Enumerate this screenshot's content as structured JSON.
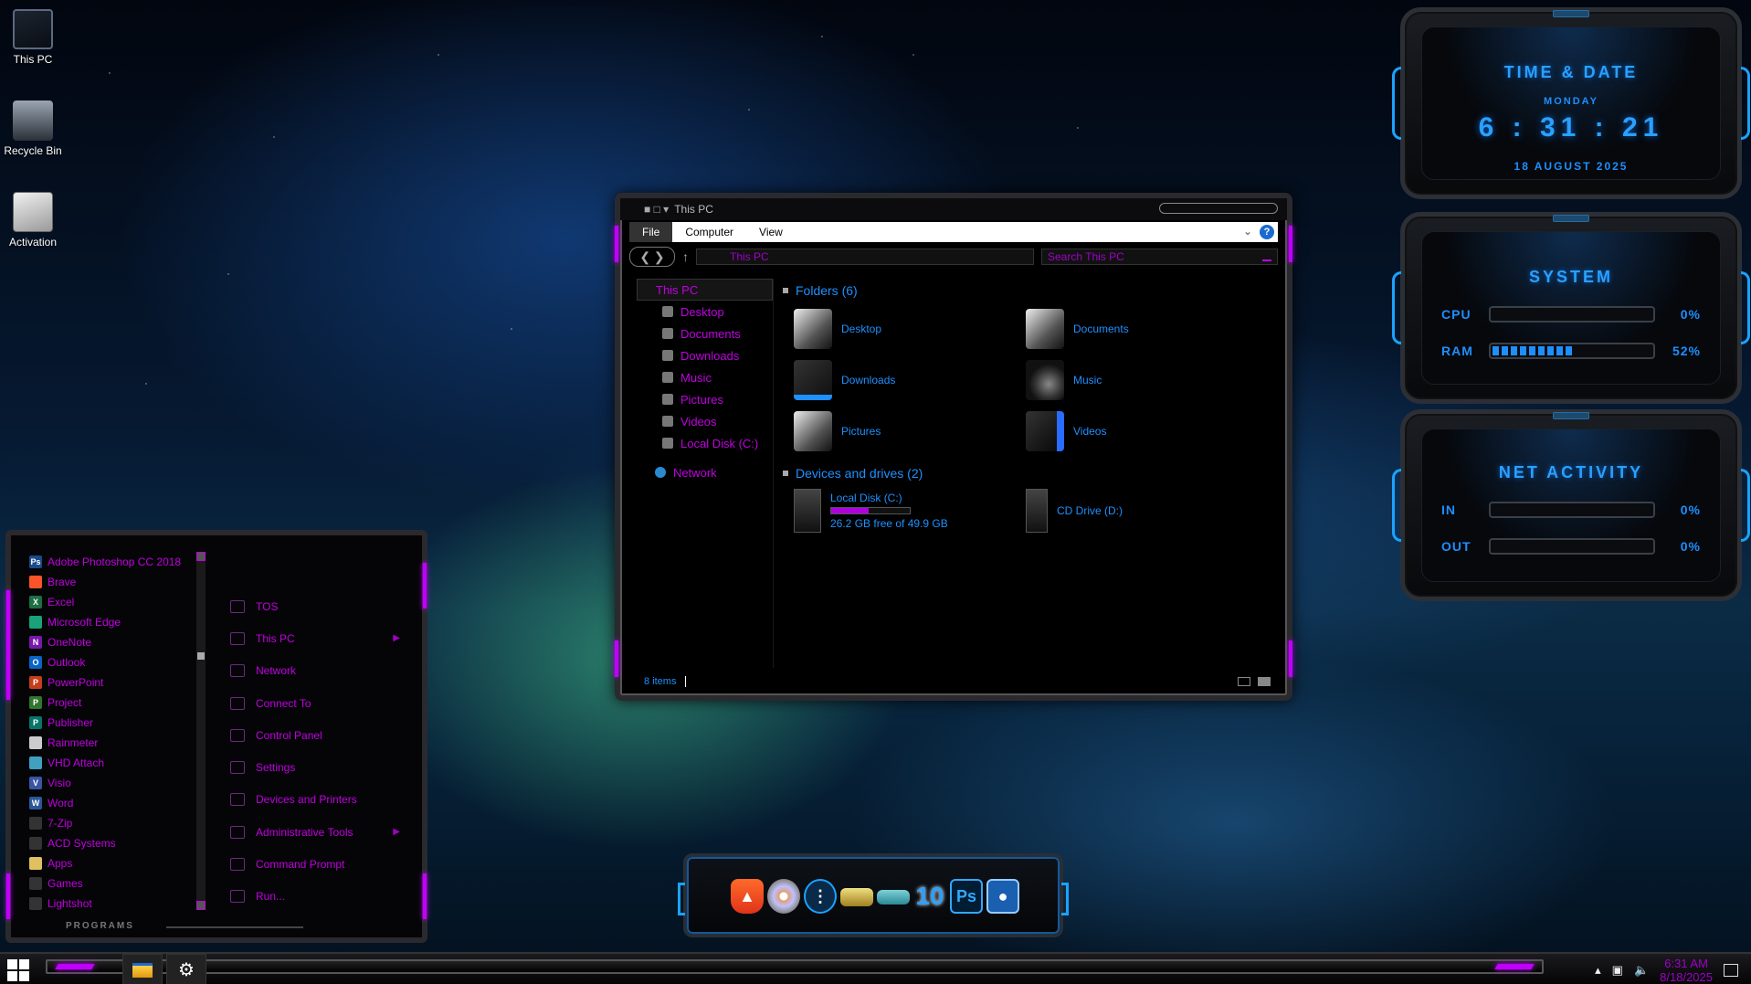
{
  "desktop": {
    "icons": [
      {
        "label": "This PC"
      },
      {
        "label": "Recycle Bin"
      },
      {
        "label": "Activation"
      }
    ]
  },
  "explorer": {
    "title": "This PC",
    "ribbon_tabs": [
      "File",
      "Computer",
      "View"
    ],
    "help_glyph": "?",
    "address": "This PC",
    "search_placeholder": "Search This PC",
    "nav": {
      "root": "This PC",
      "items": [
        "Desktop",
        "Documents",
        "Downloads",
        "Music",
        "Pictures",
        "Videos",
        "Local Disk (C:)"
      ],
      "network": "Network"
    },
    "folders_header": "Folders (6)",
    "folders": [
      "Desktop",
      "Documents",
      "Downloads",
      "Music",
      "Pictures",
      "Videos"
    ],
    "drives_header": "Devices and drives (2)",
    "drives": [
      {
        "name": "Local Disk (C:)",
        "free_text": "26.2 GB free of 49.9 GB",
        "used_fraction": 0.475
      },
      {
        "name": "CD Drive (D:)"
      }
    ],
    "status": "8 items"
  },
  "start_menu": {
    "programs": [
      {
        "label": "Adobe Photoshop CC 2018",
        "icon": "photoshop-icon",
        "badge": "Ps",
        "color": "#1a4a8a"
      },
      {
        "label": "Brave",
        "icon": "brave-icon",
        "badge": "",
        "color": "#fb542b"
      },
      {
        "label": "Excel",
        "icon": "excel-icon",
        "badge": "X",
        "color": "#1d6f42"
      },
      {
        "label": "Microsoft Edge",
        "icon": "edge-icon",
        "badge": "",
        "color": "#1aa37a"
      },
      {
        "label": "OneNote",
        "icon": "onenote-icon",
        "badge": "N",
        "color": "#7719aa"
      },
      {
        "label": "Outlook",
        "icon": "outlook-icon",
        "badge": "O",
        "color": "#0a64c8"
      },
      {
        "label": "PowerPoint",
        "icon": "powerpoint-icon",
        "badge": "P",
        "color": "#c43e1c"
      },
      {
        "label": "Project",
        "icon": "project-icon",
        "badge": "P",
        "color": "#31752f"
      },
      {
        "label": "Publisher",
        "icon": "publisher-icon",
        "badge": "P",
        "color": "#077568"
      },
      {
        "label": "Rainmeter",
        "icon": "rainmeter-icon",
        "badge": "",
        "color": "#cccccc"
      },
      {
        "label": "VHD Attach",
        "icon": "vhd-attach-icon",
        "badge": "",
        "color": "#3fa0c0"
      },
      {
        "label": "Visio",
        "icon": "visio-icon",
        "badge": "V",
        "color": "#3955a3"
      },
      {
        "label": "Word",
        "icon": "word-icon",
        "badge": "W",
        "color": "#2b579a"
      },
      {
        "label": "7-Zip",
        "icon": "folder-icon",
        "badge": "",
        "color": "#333333"
      },
      {
        "label": "ACD Systems",
        "icon": "folder-icon",
        "badge": "",
        "color": "#333333"
      },
      {
        "label": "Apps",
        "icon": "folder-icon",
        "badge": "",
        "color": "#e0c060"
      },
      {
        "label": "Games",
        "icon": "folder-icon",
        "badge": "",
        "color": "#333333"
      },
      {
        "label": "Lightshot",
        "icon": "folder-icon",
        "badge": "",
        "color": "#333333"
      }
    ],
    "places": [
      {
        "label": "TOS",
        "icon": "document-icon",
        "has_arrow": false
      },
      {
        "label": "This PC",
        "icon": "computer-icon",
        "has_arrow": true
      },
      {
        "label": "Network",
        "icon": "network-icon",
        "has_arrow": false
      },
      {
        "label": "Connect To",
        "icon": "connect-icon",
        "has_arrow": false
      },
      {
        "label": "Control Panel",
        "icon": "control-panel-icon",
        "has_arrow": false
      },
      {
        "label": "Settings",
        "icon": "settings-icon",
        "has_arrow": false
      },
      {
        "label": "Devices and Printers",
        "icon": "printer-icon",
        "has_arrow": false
      },
      {
        "label": "Administrative Tools",
        "icon": "admin-tools-icon",
        "has_arrow": true
      },
      {
        "label": "Command Prompt",
        "icon": "terminal-icon",
        "has_arrow": false
      },
      {
        "label": "Run...",
        "icon": "run-icon",
        "has_arrow": false
      }
    ],
    "footer_label": "PROGRAMS"
  },
  "widgets": {
    "time": {
      "title": "TIME & DATE",
      "day": "MONDAY",
      "time": "6 : 31 : 21",
      "date": "18 AUGUST 2025"
    },
    "system": {
      "title": "SYSTEM",
      "cpu_label": "CPU",
      "cpu_value": "0%",
      "cpu_fraction": 0,
      "ram_label": "RAM",
      "ram_value": "52%",
      "ram_fraction": 0.52
    },
    "net": {
      "title": "NET ACTIVITY",
      "in_label": "IN",
      "in_value": "0%",
      "in_fraction": 0,
      "out_label": "OUT",
      "out_value": "0%",
      "out_fraction": 0
    }
  },
  "dock": {
    "icons": [
      "brave-icon",
      "disc-icon",
      "dots-app-icon",
      "drive-icon",
      "usb-drive-icon",
      "windows-10-icon",
      "photoshop-icon",
      "camera-icon"
    ],
    "ten_label": "10",
    "ps_label": "Ps"
  },
  "taskbar": {
    "pinned": [
      "file-explorer-icon",
      "settings-gear-icon"
    ],
    "clock_time": "6:31 AM",
    "clock_date": "8/18/2025",
    "accent": "#c000ff"
  }
}
